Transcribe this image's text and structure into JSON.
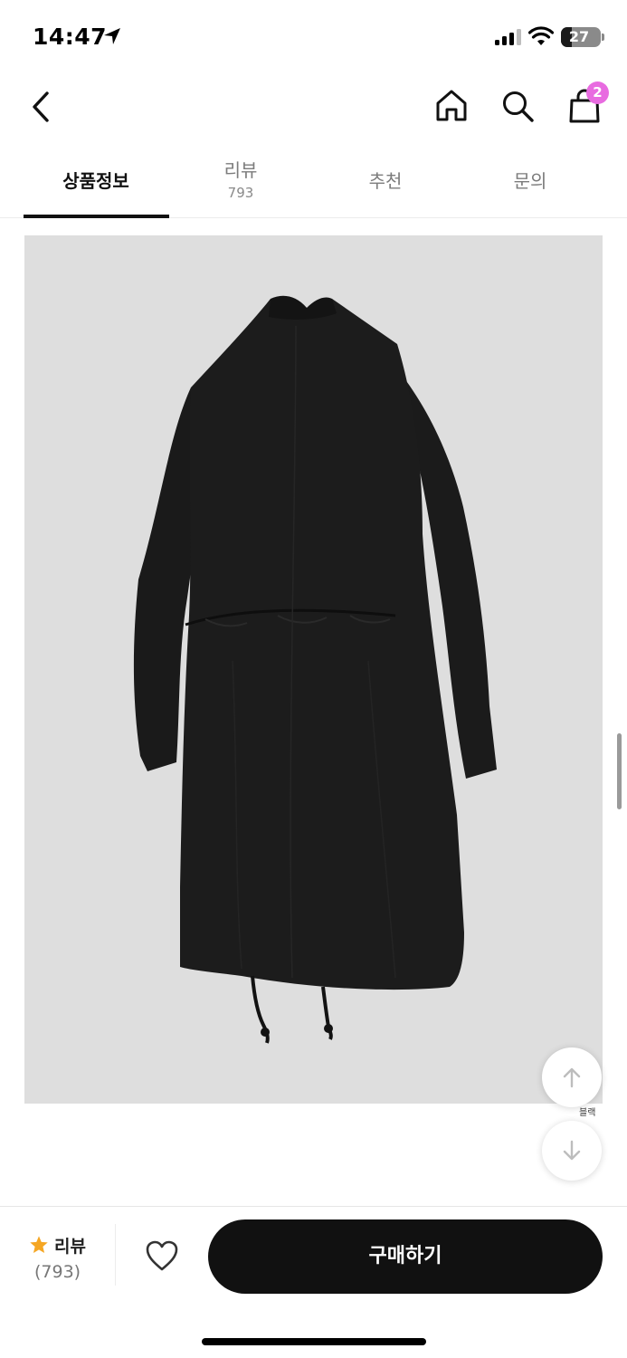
{
  "status_bar": {
    "time": "14:47",
    "battery": 27,
    "icons": [
      "location-arrow-icon",
      "signal-icon",
      "wifi-icon",
      "battery-icon"
    ]
  },
  "nav": {
    "icons": [
      "back-icon",
      "home-icon",
      "search-icon",
      "shopping-bag-icon"
    ],
    "cart_count": "2",
    "badge_color": "#e86be0"
  },
  "tabs": [
    {
      "label": "상품정보",
      "count": "",
      "active": true
    },
    {
      "label": "리뷰",
      "count": "793",
      "active": false
    },
    {
      "label": "추천",
      "count": "",
      "active": false
    },
    {
      "label": "문의",
      "count": "",
      "active": false
    }
  ],
  "product_image": {
    "subject": "black long parka coat, back view",
    "background_color": "#dedede",
    "garment_color": "#1c1c1c"
  },
  "floating": {
    "icons": [
      "arrow-up-icon",
      "arrow-down-icon"
    ],
    "color_label": "블랙"
  },
  "bottom": {
    "review_label": "리뷰",
    "review_count": "(793)",
    "buy_label": "구매하기",
    "icons": [
      "star-icon",
      "heart-icon"
    ],
    "star_color": "#f5a623",
    "button_color": "#111111"
  }
}
